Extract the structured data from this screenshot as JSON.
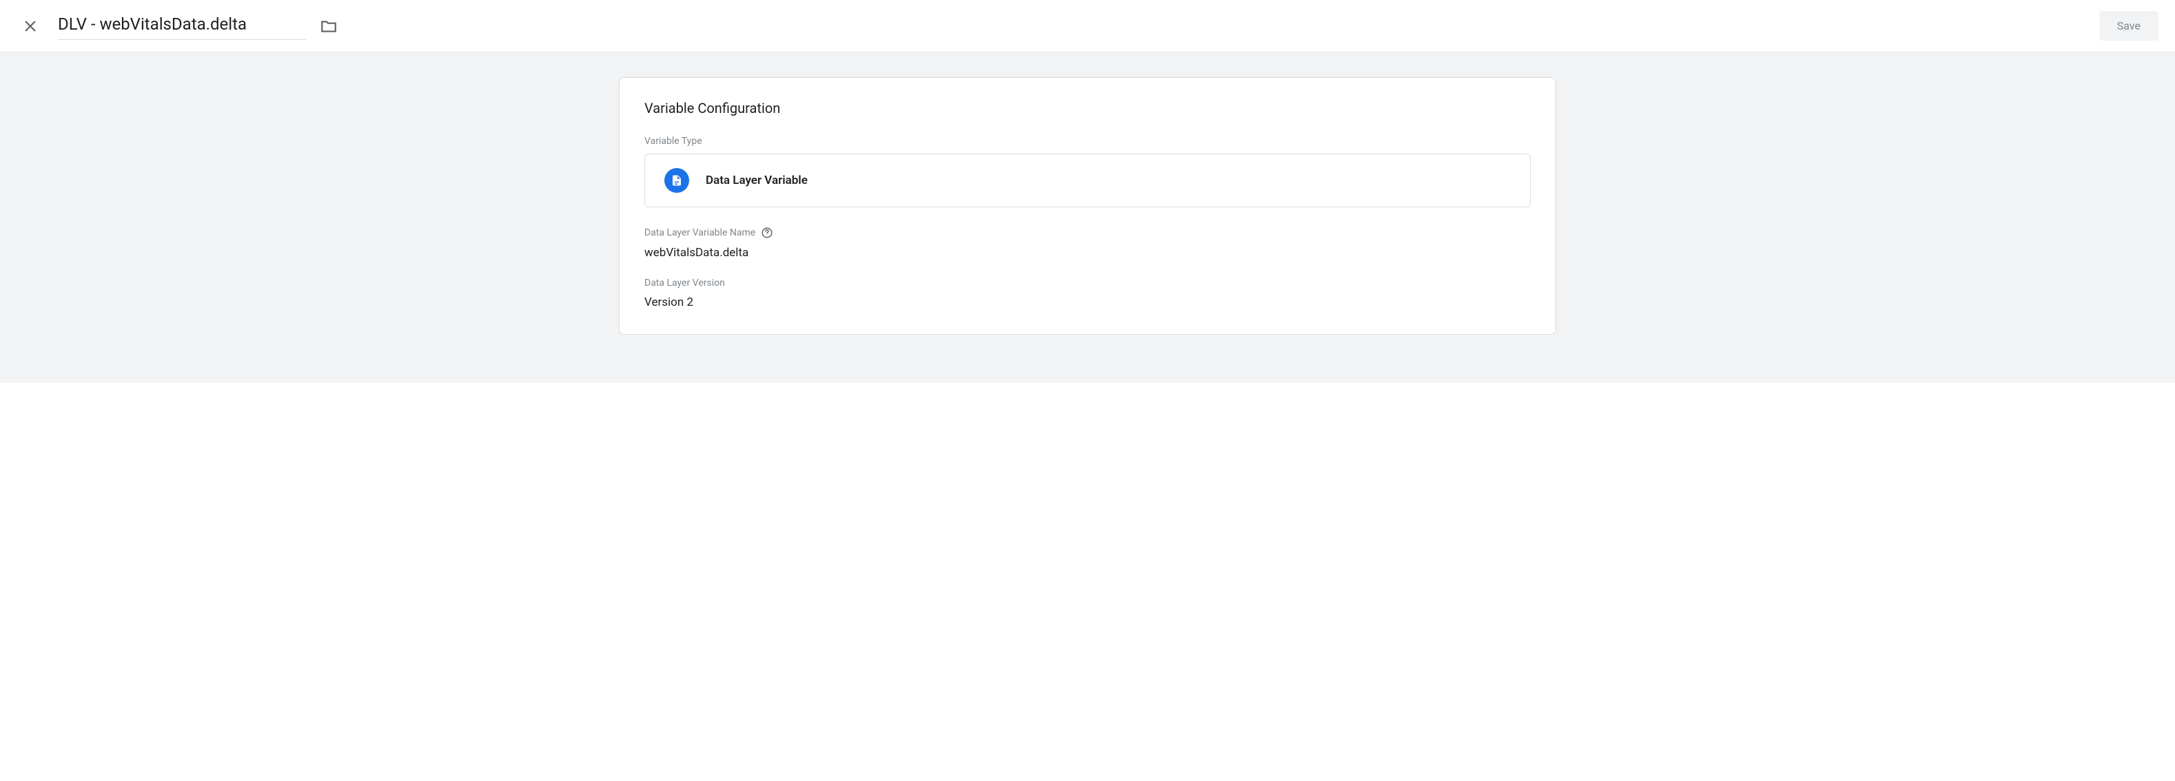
{
  "header": {
    "title": "DLV - webVitalsData.delta",
    "save_label": "Save"
  },
  "card": {
    "title": "Variable Configuration",
    "variable_type_label": "Variable Type",
    "variable_type_value": "Data Layer Variable",
    "dlv_name_label": "Data Layer Variable Name",
    "dlv_name_value": "webVitalsData.delta",
    "dlv_version_label": "Data Layer Version",
    "dlv_version_value": "Version 2"
  }
}
